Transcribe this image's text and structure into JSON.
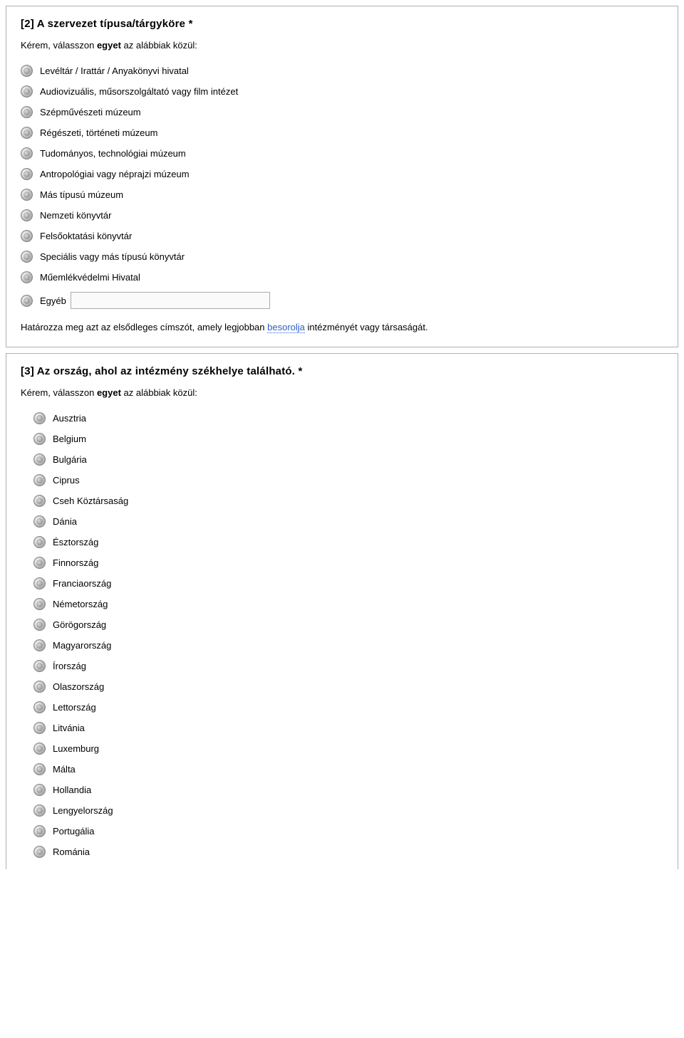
{
  "q2": {
    "title": "[2] A szervezet típusa/tárgyköre *",
    "instruction_prefix": "Kérem, válasszon ",
    "instruction_bold": "egyet",
    "instruction_suffix": " az alábbiak közül:",
    "options": [
      "Levéltár / Irattár / Anyakönyvi hivatal",
      "Audiovizuális, műsorszolgáltató vagy film intézet",
      "Szépművészeti múzeum",
      "Régészeti, történeti múzeum",
      "Tudományos, technológiai múzeum",
      "Antropológiai vagy néprajzi múzeum",
      "Más típusú múzeum",
      "Nemzeti könyvtár",
      "Felsőoktatási könyvtár",
      "Speciális vagy más típusú könyvtár",
      "Műemlékvédelmi Hivatal"
    ],
    "other_label": "Egyéb",
    "helper_prefix": "Határozza meg azt az elsődleges címszót, amely legjobban ",
    "helper_link": "besorolja",
    "helper_suffix": " intézményét vagy társaságát."
  },
  "q3": {
    "title": "[3] Az ország, ahol az intézmény székhelye található. *",
    "instruction_prefix": "Kérem, válasszon ",
    "instruction_bold": "egyet",
    "instruction_suffix": " az alábbiak közül:",
    "options": [
      "Ausztria",
      "Belgium",
      "Bulgária",
      "Ciprus",
      "Cseh Köztársaság",
      "Dánia",
      "Észtország",
      "Finnország",
      "Franciaország",
      "Németország",
      "Görögország",
      "Magyarország",
      "Írország",
      "Olaszország",
      "Lettország",
      "Litvánia",
      "Luxemburg",
      "Málta",
      "Hollandia",
      "Lengyelország",
      "Portugália",
      "Románia"
    ]
  }
}
